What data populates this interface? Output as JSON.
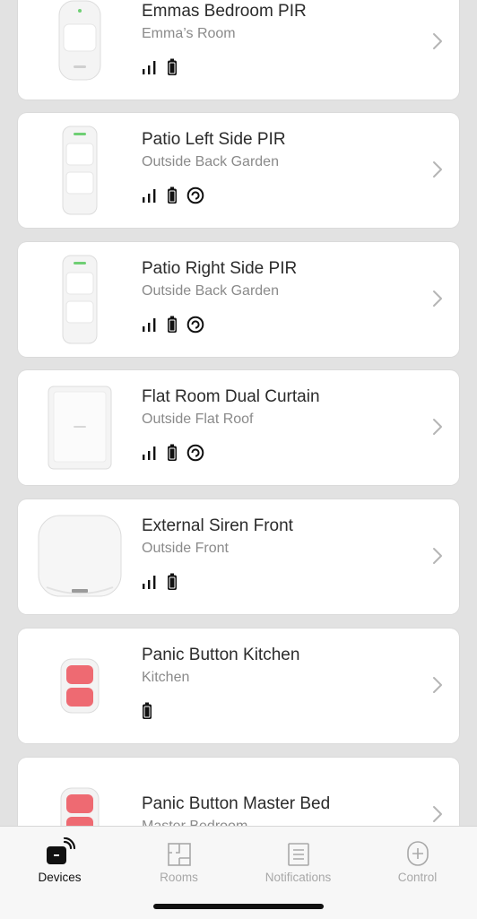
{
  "devices": [
    {
      "name": "Emmas Bedroom PIR",
      "room": "Emma’s Room",
      "status_icons": [
        "signal-icon",
        "battery-icon"
      ]
    },
    {
      "name": "Patio Left Side PIR",
      "room": "Outside Back Garden",
      "status_icons": [
        "signal-icon",
        "battery-icon",
        "lid-icon"
      ]
    },
    {
      "name": "Patio Right Side PIR",
      "room": "Outside Back Garden",
      "status_icons": [
        "signal-icon",
        "battery-icon",
        "lid-icon"
      ]
    },
    {
      "name": "Flat Room Dual Curtain",
      "room": "Outside Flat Roof",
      "status_icons": [
        "signal-icon",
        "battery-icon",
        "lid-icon"
      ]
    },
    {
      "name": "External Siren Front",
      "room": "Outside Front",
      "status_icons": [
        "signal-icon",
        "battery-icon"
      ]
    },
    {
      "name": "Panic Button Kitchen",
      "room": "Kitchen",
      "status_icons": [
        "battery-icon"
      ]
    },
    {
      "name": "Panic Button Master Bed",
      "room": "Master Bedroom",
      "status_icons": []
    }
  ],
  "tabs": [
    {
      "label": "Devices",
      "icon": "devices-icon",
      "active": true
    },
    {
      "label": "Rooms",
      "icon": "rooms-icon",
      "active": false
    },
    {
      "label": "Notifications",
      "icon": "notifications-icon",
      "active": false
    },
    {
      "label": "Control",
      "icon": "control-icon",
      "active": false
    }
  ],
  "colors": {
    "background": "#e2e2e2",
    "card": "#ffffff",
    "active_tab": "#111111",
    "inactive_tab": "#a8a8a8",
    "panic_red": "#ee6a72"
  }
}
